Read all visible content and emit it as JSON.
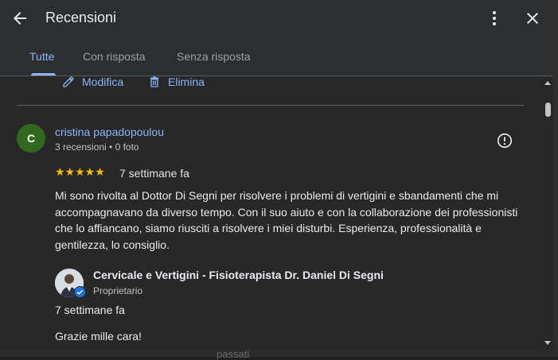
{
  "header": {
    "title": "Recensioni",
    "tabs": [
      {
        "label": "Tutte",
        "active": true
      },
      {
        "label": "Con risposta",
        "active": false
      },
      {
        "label": "Senza risposta",
        "active": false
      }
    ]
  },
  "actions": {
    "edit_label": "Modifica",
    "delete_label": "Elimina"
  },
  "review": {
    "avatar_letter": "C",
    "author": "cristina papadopoulou",
    "meta": "3 recensioni • 0 foto",
    "rating": 5,
    "stars": "★★★★★",
    "date": "7 settimane fa",
    "text": "Mi sono rivolta al Dottor Di Segni per risolvere i problemi di vertigini e sbandamenti che mi accompagnavano da diverso tempo. Con il suo aiuto e con la collaborazione dei professionisti che lo affiancano, siamo riusciti a risolvere i miei disturbi. Esperienza, professionalità e gentilezza, lo consiglio."
  },
  "owner_reply": {
    "name": "Cervicale e Vertigini - Fisioterapista Dr. Daniel Di Segni",
    "role": "Proprietario",
    "date": "7 settimane fa",
    "text": "Grazie mille cara!"
  },
  "background": {
    "ghost_text": "passati"
  },
  "colors": {
    "accent": "#8ab4f8",
    "star": "#fbbc04",
    "avatar_bg": "#33691e",
    "verified": "#1a73e8"
  }
}
